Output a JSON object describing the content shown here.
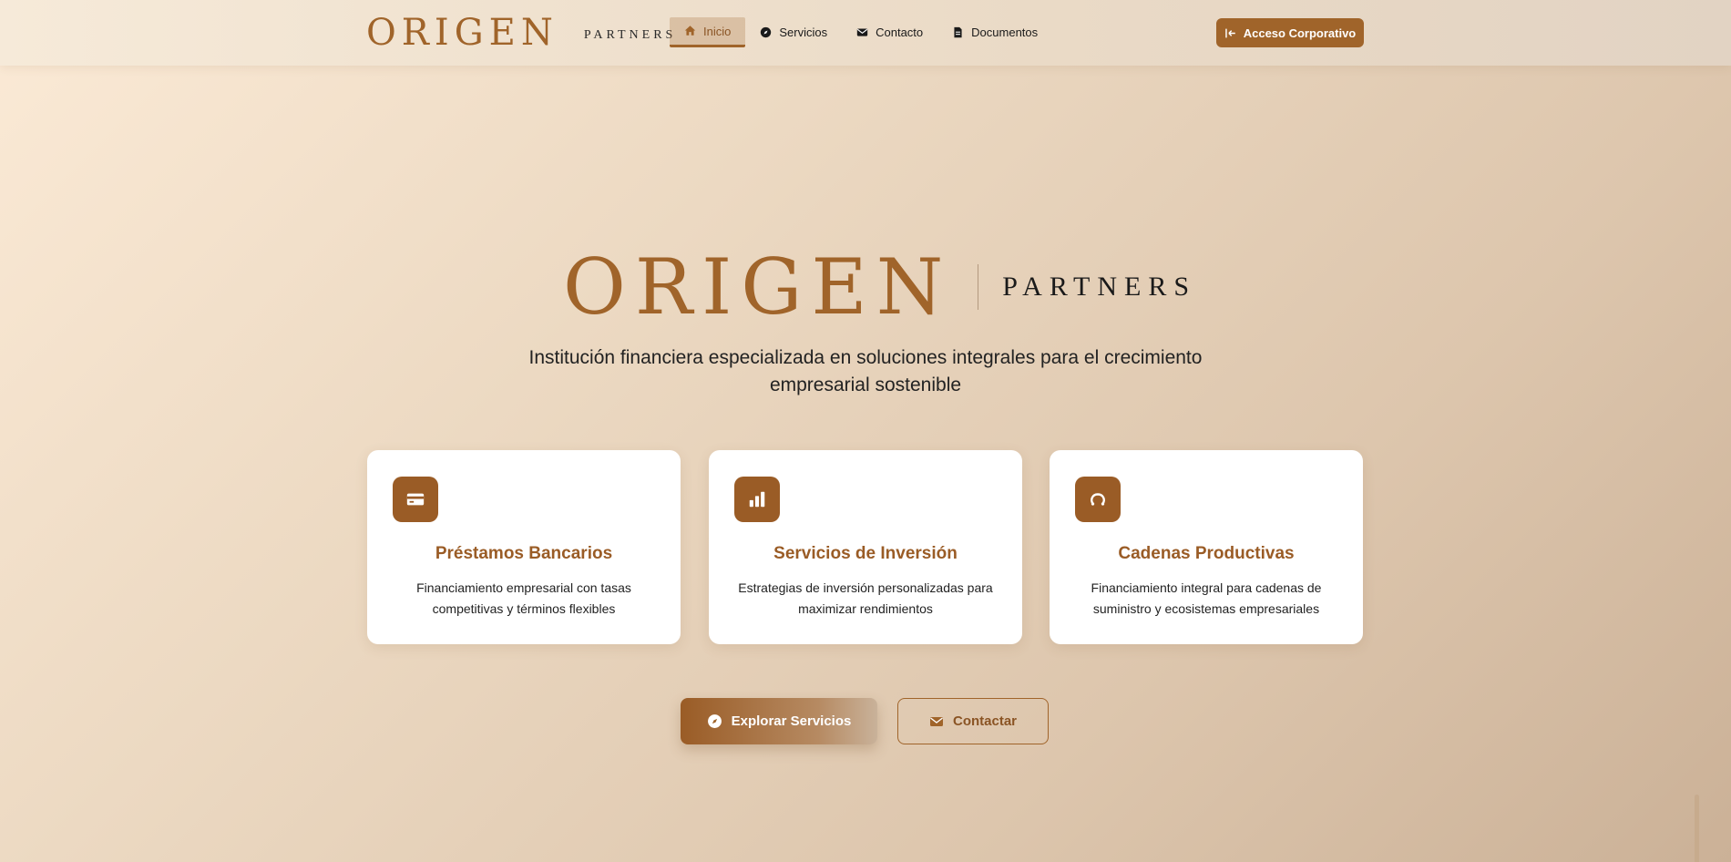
{
  "nav": {
    "logo_main": "ORIGEN",
    "logo_sub": "PARTNERS",
    "links": [
      {
        "label": "Inicio",
        "icon": "home-icon",
        "active": true
      },
      {
        "label": "Servicios",
        "icon": "compass-icon",
        "active": false
      },
      {
        "label": "Contacto",
        "icon": "envelope-icon",
        "active": false
      },
      {
        "label": "Documentos",
        "icon": "document-icon",
        "active": false
      }
    ],
    "corporate_button": "Acceso Corporativo"
  },
  "hero": {
    "logo_main": "ORIGEN",
    "logo_sub": "PARTNERS",
    "tagline": "Institución financiera especializada en soluciones integrales para el crecimiento empresarial sostenible"
  },
  "services": [
    {
      "title": "Préstamos Bancarios",
      "description": "Financiamiento empresarial con tasas competitivas y términos flexibles",
      "icon": "credit-card-icon"
    },
    {
      "title": "Servicios de Inversión",
      "description": "Estrategias de inversión personalizadas para maximizar rendimientos",
      "icon": "bar-chart-icon"
    },
    {
      "title": "Cadenas Productivas",
      "description": "Financiamiento integral para cadenas de suministro y ecosistemas empresariales",
      "icon": "link-icon"
    }
  ],
  "cta": {
    "explore": "Explorar Servicios",
    "contact": "Contactar"
  },
  "colors": {
    "brand": "#a0642a",
    "background_start": "#fbead6",
    "background_end": "#cbb197"
  }
}
